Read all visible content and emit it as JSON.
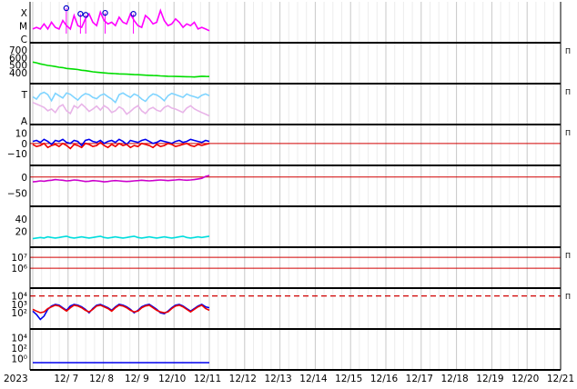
{
  "chart_data": {
    "type": "line",
    "x_axis": {
      "start_label": "2023",
      "day_labels": [
        "12/ 7",
        "12/ 8",
        "12/ 9",
        "12/10",
        "12/11",
        "12/12",
        "12/13",
        "12/14",
        "12/15",
        "12/16",
        "12/17",
        "12/18",
        "12/19",
        "12/20",
        "12/21"
      ],
      "data_end_day_index": 5.0
    },
    "panels": [
      {
        "id": "xray",
        "y_tick_labels": [
          "X",
          "M",
          "C"
        ],
        "right_label": "",
        "series": [
          {
            "color": "#ff00ff",
            "values": [
              0.3,
              0.35,
              0.3,
              0.45,
              0.3,
              0.5,
              0.35,
              0.3,
              0.55,
              0.4,
              0.3,
              0.7,
              0.4,
              0.35,
              0.6,
              0.75,
              0.5,
              0.4,
              0.8,
              0.55,
              0.45,
              0.5,
              0.4,
              0.65,
              0.5,
              0.45,
              0.75,
              0.55,
              0.4,
              0.35,
              0.7,
              0.6,
              0.45,
              0.5,
              0.85,
              0.55,
              0.4,
              0.45,
              0.6,
              0.5,
              0.35,
              0.45,
              0.4,
              0.5,
              0.3,
              0.35,
              0.3,
              0.25
            ]
          }
        ],
        "flares": [
          {
            "x": 1.95,
            "y": 0.92
          },
          {
            "x": 2.35,
            "y": 0.75
          },
          {
            "x": 2.5,
            "y": 0.72
          },
          {
            "x": 3.05,
            "y": 0.78
          },
          {
            "x": 3.85,
            "y": 0.75
          }
        ]
      },
      {
        "id": "wind_speed",
        "y_tick_labels": [
          "700",
          "600",
          "500",
          "400"
        ],
        "y_tick_values": [
          700,
          600,
          500,
          400
        ],
        "ylim": [
          300,
          750
        ],
        "right_label": "Π",
        "series": [
          {
            "color": "#00dd00",
            "values": [
              540,
              530,
              515,
              505,
              495,
              488,
              480,
              470,
              465,
              455,
              450,
              445,
              440,
              430,
              425,
              418,
              410,
              405,
              400,
              395,
              390,
              388,
              385,
              382,
              380,
              378,
              375,
              372,
              370,
              368,
              365,
              362,
              360,
              358,
              355,
              352,
              350,
              349,
              348,
              346,
              345,
              344,
              342,
              340,
              345,
              350,
              348,
              346
            ]
          }
        ]
      },
      {
        "id": "wind_temp",
        "y_tick_labels": [
          "T",
          "A"
        ],
        "right_label": "Π",
        "series": [
          {
            "color": "#7fd4ff",
            "values": [
              0.72,
              0.65,
              0.8,
              0.85,
              0.78,
              0.6,
              0.82,
              0.75,
              0.68,
              0.83,
              0.79,
              0.7,
              0.62,
              0.74,
              0.81,
              0.78,
              0.7,
              0.66,
              0.76,
              0.8,
              0.72,
              0.65,
              0.55,
              0.78,
              0.83,
              0.76,
              0.7,
              0.8,
              0.75,
              0.65,
              0.58,
              0.72,
              0.8,
              0.77,
              0.7,
              0.6,
              0.75,
              0.82,
              0.78,
              0.74,
              0.7,
              0.8,
              0.75,
              0.72,
              0.68,
              0.76,
              0.8,
              0.75
            ]
          },
          {
            "color": "#e8b4e8",
            "values": [
              0.55,
              0.5,
              0.45,
              0.4,
              0.3,
              0.35,
              0.25,
              0.42,
              0.48,
              0.3,
              0.22,
              0.45,
              0.38,
              0.5,
              0.4,
              0.28,
              0.35,
              0.44,
              0.32,
              0.45,
              0.38,
              0.25,
              0.3,
              0.42,
              0.35,
              0.2,
              0.28,
              0.38,
              0.45,
              0.3,
              0.22,
              0.35,
              0.4,
              0.32,
              0.28,
              0.4,
              0.45,
              0.38,
              0.35,
              0.3,
              0.25,
              0.38,
              0.45,
              0.36,
              0.3,
              0.25,
              0.2,
              0.15
            ]
          }
        ]
      },
      {
        "id": "bz",
        "y_tick_labels": [
          "10",
          "0",
          "−10"
        ],
        "y_tick_values": [
          10,
          0,
          -10
        ],
        "ylim": [
          -18,
          15
        ],
        "zero_line": 0,
        "right_label": "Π",
        "series": [
          {
            "color": "#0000ee",
            "values": [
              2,
              3,
              1,
              4,
              2,
              -1,
              3,
              2,
              4,
              1,
              0,
              3,
              2,
              -2,
              3,
              4,
              2,
              1,
              3,
              0,
              2,
              3,
              1,
              4,
              2,
              -1,
              3,
              2,
              1,
              3,
              4,
              2,
              0,
              1,
              3,
              2,
              1,
              0,
              2,
              3,
              1,
              2,
              4,
              3,
              2,
              1,
              3,
              2
            ]
          },
          {
            "color": "#ee0000",
            "values": [
              -1,
              -3,
              -2,
              0,
              -4,
              -2,
              -1,
              -3,
              0,
              -2,
              -5,
              -1,
              -2,
              -4,
              0,
              -1,
              -3,
              -2,
              1,
              -2,
              -4,
              -1,
              -3,
              0,
              -2,
              -1,
              -4,
              -2,
              -3,
              0,
              -1,
              -2,
              -4,
              -1,
              -3,
              -2,
              0,
              -1,
              -3,
              -2,
              -1,
              0,
              -2,
              -3,
              -1,
              -2,
              -1,
              0
            ]
          }
        ]
      },
      {
        "id": "dst",
        "y_tick_labels": [
          "0",
          "−50"
        ],
        "y_tick_values": [
          0,
          -50
        ],
        "ylim": [
          -80,
          25
        ],
        "zero_line": 0,
        "right_label": "",
        "series": [
          {
            "color": "#cc00cc",
            "values": [
              -15,
              -14,
              -12,
              -13,
              -11,
              -10,
              -8,
              -9,
              -10,
              -12,
              -11,
              -9,
              -10,
              -12,
              -14,
              -13,
              -11,
              -12,
              -13,
              -15,
              -14,
              -12,
              -11,
              -12,
              -13,
              -14,
              -13,
              -12,
              -11,
              -10,
              -11,
              -12,
              -11,
              -10,
              -9,
              -10,
              -11,
              -10,
              -9,
              -8,
              -9,
              -10,
              -9,
              -8,
              -6,
              -4,
              2,
              5
            ]
          }
        ]
      },
      {
        "id": "kp",
        "y_tick_labels": [
          "40",
          "20"
        ],
        "y_tick_values": [
          40,
          20
        ],
        "ylim": [
          0,
          55
        ],
        "right_label": "",
        "series": [
          {
            "color": "#00dddd",
            "values": [
              8,
              9,
              10,
              9,
              11,
              10,
              9,
              10,
              11,
              12,
              10,
              9,
              10,
              11,
              10,
              9,
              10,
              11,
              12,
              10,
              9,
              10,
              11,
              10,
              9,
              10,
              11,
              12,
              10,
              9,
              10,
              11,
              10,
              9,
              10,
              11,
              10,
              9,
              10,
              11,
              12,
              10,
              9,
              10,
              11,
              10,
              11,
              12
            ]
          }
        ]
      },
      {
        "id": "proton",
        "y_tick_labels": [
          "10⁷",
          "10⁶"
        ],
        "y_tick_values": [
          7,
          6
        ],
        "ylim": [
          4.5,
          7.6
        ],
        "red_lines": [
          7,
          6
        ],
        "right_label": "Π",
        "series": []
      },
      {
        "id": "electron",
        "y_tick_labels": [
          "10⁴",
          "10³",
          "10²"
        ],
        "y_tick_values": [
          4,
          3,
          2
        ],
        "ylim": [
          0.5,
          4.5
        ],
        "dashed_line": 4,
        "right_label": "Π",
        "series": [
          {
            "color": "#0000ee",
            "values": [
              2.2,
              1.8,
              1.2,
              1.6,
              2.4,
              2.8,
              3.0,
              2.9,
              2.6,
              2.3,
              2.8,
              3.0,
              2.9,
              2.7,
              2.4,
              2.0,
              2.5,
              2.9,
              3.0,
              2.8,
              2.6,
              2.3,
              2.7,
              3.0,
              2.9,
              2.7,
              2.4,
              2.0,
              2.3,
              2.7,
              2.9,
              3.0,
              2.7,
              2.4,
              2.0,
              1.9,
              2.2,
              2.6,
              2.9,
              3.0,
              2.8,
              2.5,
              2.2,
              2.5,
              2.8,
              3.0,
              2.7,
              2.6
            ]
          },
          {
            "color": "#ee0000",
            "values": [
              2.4,
              2.2,
              2.0,
              2.1,
              2.5,
              2.7,
              2.9,
              2.8,
              2.5,
              2.2,
              2.6,
              2.9,
              2.8,
              2.6,
              2.3,
              2.1,
              2.4,
              2.8,
              2.9,
              2.7,
              2.5,
              2.2,
              2.6,
              2.9,
              2.8,
              2.6,
              2.3,
              2.1,
              2.2,
              2.6,
              2.8,
              2.9,
              2.6,
              2.3,
              2.1,
              2.0,
              2.1,
              2.5,
              2.8,
              2.9,
              2.7,
              2.4,
              2.1,
              2.4,
              2.7,
              2.9,
              2.5,
              2.3
            ]
          }
        ]
      },
      {
        "id": "neutron",
        "y_tick_labels": [
          "10⁴",
          "10²",
          "10⁰"
        ],
        "y_tick_values": [
          4,
          2,
          0
        ],
        "ylim": [
          -1.5,
          5
        ],
        "right_label": "",
        "series": [
          {
            "color": "#0000ee",
            "values": [
              -0.8,
              -0.8,
              -0.8,
              -0.8,
              -0.8,
              -0.8,
              -0.8,
              -0.8,
              -0.8,
              -0.8,
              -0.8,
              -0.8,
              -0.8,
              -0.8,
              -0.8,
              -0.8,
              -0.8,
              -0.8,
              -0.8,
              -0.8,
              -0.8,
              -0.8,
              -0.8,
              -0.8,
              -0.8,
              -0.8,
              -0.8,
              -0.8,
              -0.8,
              -0.8,
              -0.8,
              -0.8,
              -0.8,
              -0.8,
              -0.8,
              -0.8,
              -0.8,
              -0.8,
              -0.8,
              -0.8,
              -0.8,
              -0.8,
              -0.8,
              -0.8,
              -0.8,
              -0.8,
              -0.8,
              -0.8
            ]
          }
        ]
      }
    ]
  }
}
